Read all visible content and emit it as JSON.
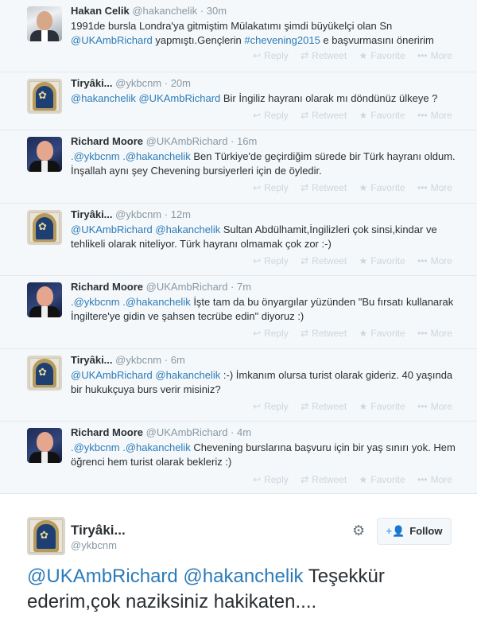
{
  "actions": {
    "reply": "Reply",
    "retweet": "Retweet",
    "favorite": "Favorite",
    "more": "More"
  },
  "icons": {
    "reply": "reply-icon",
    "retweet": "retweet-icon",
    "favorite": "star-icon",
    "more": "more-icon",
    "settings": "gear-icon",
    "follow": "follow-user-icon"
  },
  "colors": {
    "link": "#2b7bb9",
    "muted": "#8899a6",
    "action": "#ccd6dd",
    "background": "#f5f8fa"
  },
  "tweets": [
    {
      "name": "Hakan Celik",
      "handle": "@hakanchelik",
      "time": "30m",
      "line1": "1991de bursla Londra'ya gitmiştim Mülakatımı şimdi büyükelçi olan Sn",
      "m1": "@UKAmbRichard",
      "t1": " yapmıştı.Gençlerin ",
      "m2": "#chevening2015",
      "t2": " e başvurmasını öneririm"
    },
    {
      "name": "Tiryâki...",
      "handle": "@ykbcnm",
      "time": "20m",
      "m1": "@hakanchelik",
      "sp": " ",
      "m2": "@UKAmbRichard",
      "t1": " Bir İngiliz hayranı olarak mı döndünüz ülkeye ?"
    },
    {
      "name": "Richard Moore",
      "handle": "@UKAmbRichard",
      "time": "16m",
      "m1": ".@ykbcnm",
      "sp": " ",
      "m2": ".@hakanchelik",
      "t1": " Ben Türkiye'de geçirdiğim sürede bir Türk hayranı oldum. İnşallah aynı şey Chevening bursiyerleri için de öyledir."
    },
    {
      "name": "Tiryâki...",
      "handle": "@ykbcnm",
      "time": "12m",
      "m1": "@UKAmbRichard",
      "sp": " ",
      "m2": "@hakanchelik",
      "t1": " Sultan Abdülhamit,İngilizleri çok sinsi,kindar ve tehlikeli olarak niteliyor. Türk hayranı olmamak çok zor :-)"
    },
    {
      "name": "Richard Moore",
      "handle": "@UKAmbRichard",
      "time": "7m",
      "m1": ".@ykbcnm",
      "sp": " ",
      "m2": ".@hakanchelik",
      "t1": " İşte tam da bu önyargılar yüzünden \"Bu fırsatı kullanarak İngiltere'ye gidin ve şahsen tecrübe edin\" diyoruz :)"
    },
    {
      "name": "Tiryâki...",
      "handle": "@ykbcnm",
      "time": "6m",
      "m1": "@UKAmbRichard",
      "sp": " ",
      "m2": "@hakanchelik",
      "t1": " :-) İmkanım olursa turist olarak gideriz. 40 yaşında bir hukukçuya burs verir misiniz?"
    },
    {
      "name": "Richard Moore",
      "handle": "@UKAmbRichard",
      "time": "4m",
      "m1": ".@ykbcnm",
      "sp": " ",
      "m2": ".@hakanchelik",
      "t1": " Chevening burslarına başvuru için bir yaş sınırı yok. Hem öğrenci hem turist olarak bekleriz :)"
    }
  ],
  "main": {
    "name": "Tiryâki...",
    "handle": "@ykbcnm",
    "follow": "Follow",
    "m1": "@UKAmbRichard",
    "sp": " ",
    "m2": "@hakanchelik",
    "t1": " Teşekkür ederim,çok naziksiniz hakikaten...."
  }
}
